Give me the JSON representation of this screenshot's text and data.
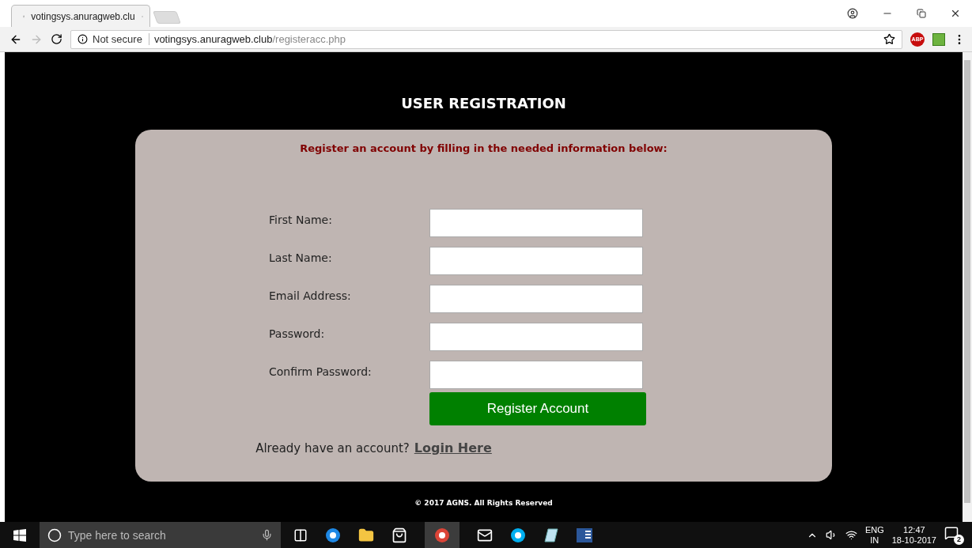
{
  "browser": {
    "tab_title": "votingsys.anuragweb.clu",
    "security": "Not secure",
    "url_host": "votingsys.anuragweb.club",
    "url_path": "/registeracc.php",
    "extension_label": "ABP"
  },
  "page": {
    "title": "USER REGISTRATION",
    "subtitle": "Register an account by filling in the needed information below:",
    "fields": [
      {
        "label": "First Name:"
      },
      {
        "label": "Last Name:"
      },
      {
        "label": "Email Address:"
      },
      {
        "label": "Password:"
      },
      {
        "label": "Confirm Password:"
      }
    ],
    "submit": "Register Account",
    "login_prompt": "Already have an account?",
    "login_link": "Login Here",
    "footer": "© 2017 AGNS. All Rights Reserved"
  },
  "taskbar": {
    "search_placeholder": "Type here to search",
    "language": "ENG",
    "region": "IN",
    "time": "12:47",
    "date": "18-10-2017",
    "notification_count": "2"
  }
}
